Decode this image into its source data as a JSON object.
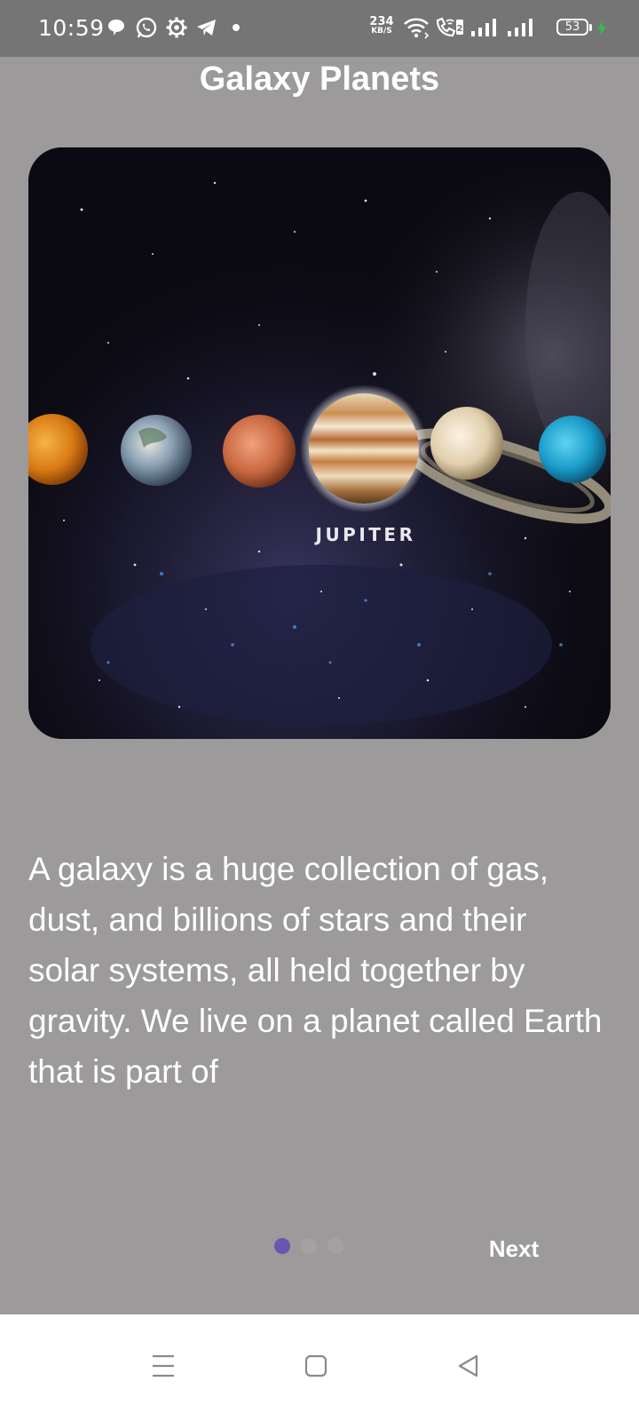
{
  "status_bar": {
    "time": "10:59",
    "left_icons": [
      "chat-bubble-icon",
      "whatsapp-icon",
      "settings-gear-icon",
      "telegram-icon",
      "dot-icon"
    ],
    "net_speed_value": "234",
    "net_speed_unit": "KB/S",
    "right_icons": [
      "wifi-icon",
      "wifi-calling-icon",
      "signal-icon",
      "signal-icon"
    ],
    "battery_level": "53",
    "charging": true
  },
  "app": {
    "title": "Galaxy Planets",
    "image": {
      "planet_label": "JUPITER",
      "planets": [
        "venus",
        "earth",
        "mars",
        "jupiter",
        "saturn",
        "uranus"
      ]
    },
    "description": "A galaxy is a huge collection of gas, dust, and billions of stars and their solar systems, all held together by gravity. We live on a planet called Earth that is part of",
    "pager": {
      "page_count": 3,
      "current_page": 1,
      "active_color": "#6a55b0",
      "inactive_color": "#a3a1a2"
    },
    "next_label": "Next"
  },
  "nav_bar": {
    "buttons": [
      "menu-icon",
      "home-icon",
      "back-icon"
    ]
  }
}
